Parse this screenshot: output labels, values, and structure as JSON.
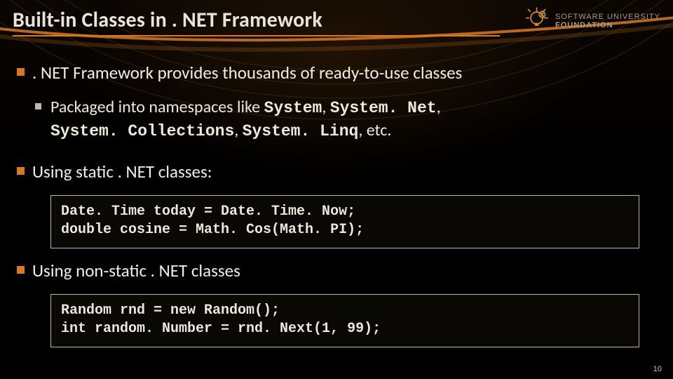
{
  "title": "Built-in Classes in . NET Framework",
  "logo": {
    "line1": "SOFTWARE UNIVERSITY",
    "line2": "FOUNDATION"
  },
  "bullets": {
    "b1_text": ". NET Framework provides thousands of ready-to-use classes",
    "b2_prefix": "Packaged into namespaces like ",
    "ns1": "System",
    "sep": ", ",
    "ns2": "System. Net",
    "ns3": "System. Collections",
    "ns4": "System. Linq",
    "b2_suffix": ", etc.",
    "b3_text": "Using static . NET classes:",
    "b4_text": "Using non-static . NET classes"
  },
  "code1": "Date. Time today = Date. Time. Now;\ndouble cosine = Math. Cos(Math. PI);",
  "code2": "Random rnd = new Random();\nint random. Number = rnd. Next(1, 99);",
  "page_number": "10"
}
